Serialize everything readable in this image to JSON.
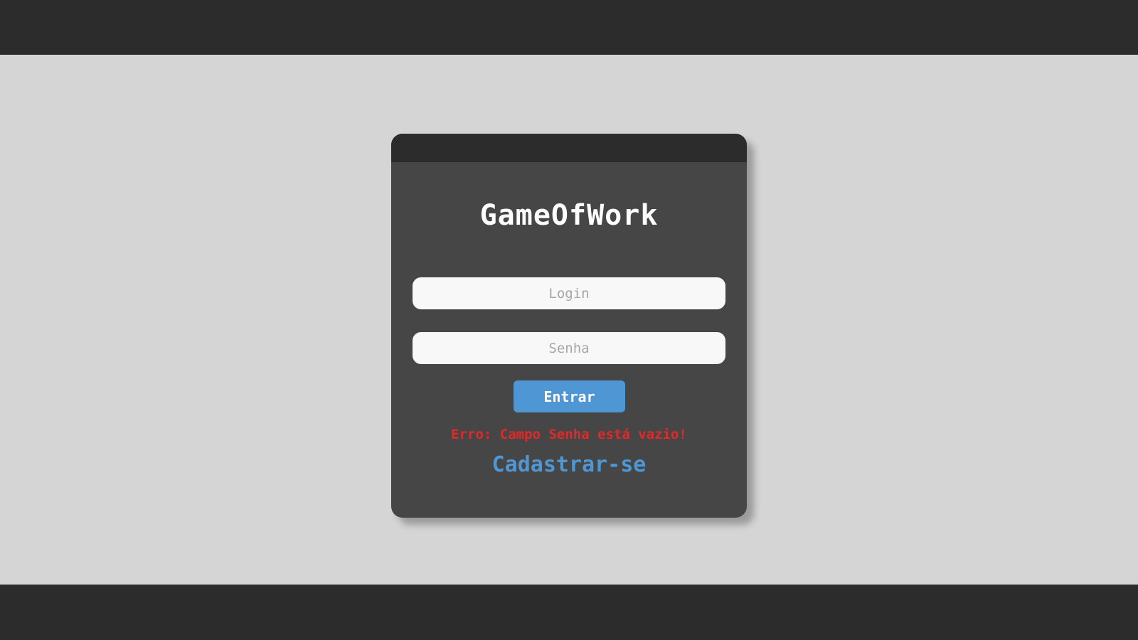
{
  "app": {
    "title": "GameOfWork"
  },
  "login_form": {
    "login_placeholder": "Login",
    "login_value": "",
    "senha_placeholder": "Senha",
    "senha_value": "",
    "submit_label": "Entrar",
    "error_message": "Erro: Campo Senha está vazio!",
    "signup_link": "Cadastrar-se"
  },
  "colors": {
    "header_bar": "#2c2c2c",
    "background": "#d5d5d5",
    "card": "#464646",
    "accent_blue": "#4f97d4",
    "error_red": "#e02a2a"
  }
}
